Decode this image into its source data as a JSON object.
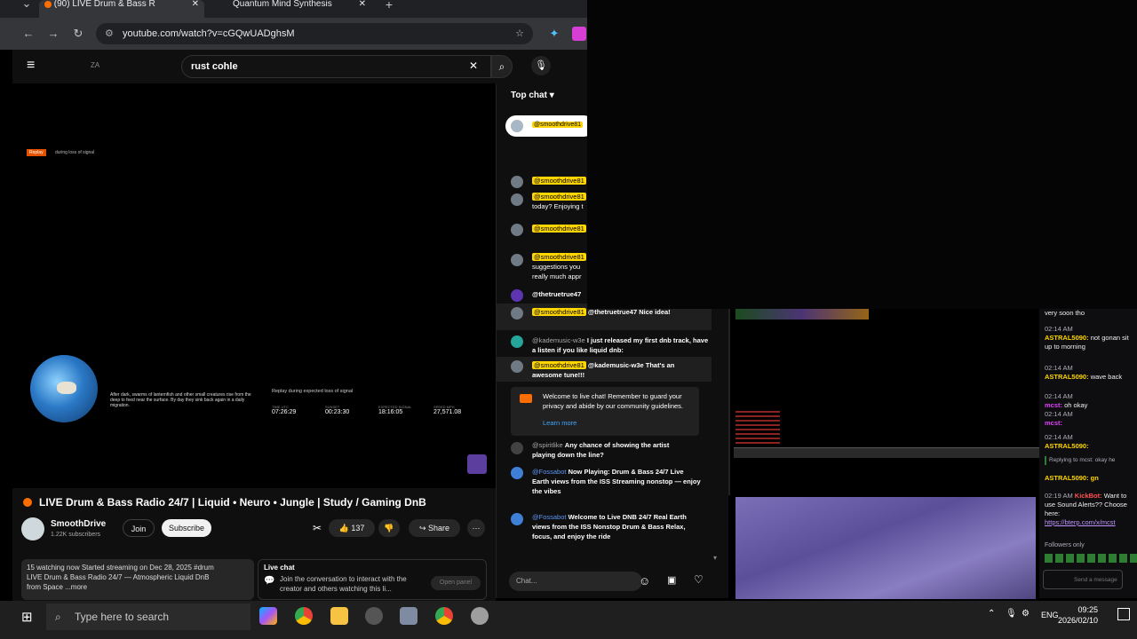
{
  "browser": {
    "tabs": [
      {
        "label": "(90)   LIVE Drum & Bass R"
      },
      {
        "label": "Quantum Mind Synthesis"
      }
    ],
    "url": "youtube.com/watch?v=cGQwUADghsM"
  },
  "youtube": {
    "logo_text": "ZA",
    "search_value": "rust cohle",
    "video_title": "LIVE Drum & Bass Radio 24/7 | Liquid • Neuro • Jungle | Study / Gaming DnB",
    "channel_name": "SmoothDrive",
    "subscribers": "1.22K subscribers",
    "join_label": "Join",
    "subscribe_label": "Subscribe",
    "likes": "137",
    "share_label": "Share",
    "description": "15 watching now  Started streaming on Dec 28, 2025  #drum",
    "description_line2": "LIVE Drum & Bass Radio 24/7 — Atmospheric Liquid DnB",
    "description_line3": "from Space ...more",
    "livechat_box_title": "Live chat",
    "livechat_box_text": "Join the conversation to interact with the creator and others watching this li...",
    "open_panel_label": "Open panel"
  },
  "player": {
    "replay_badge": "Replay",
    "replay_caption": "during loss of signal",
    "caption_text": "After dark, swarms of lanternfish and other small creatures rise from the deep to feed near the surface. By day they sink back again in a daily migration.",
    "panel_title": "Replay during expected loss of signal",
    "stats": [
      {
        "label": "TIME UTC",
        "value": "07:26:29"
      },
      {
        "label": "SUNSET",
        "value": "00:23:30"
      },
      {
        "label": "EXPECTED SIGNAL",
        "value": "18:16:05"
      },
      {
        "label": "SPEED MPH",
        "value": "27,571.08"
      }
    ]
  },
  "chat": {
    "header": "Top chat",
    "pinned": "@smoothdrive81",
    "messages": [
      {
        "user": "@smoothdrive81",
        "text": ""
      },
      {
        "user": "@smoothdrive81",
        "text": "today? Enjoying t"
      },
      {
        "user": "@smoothdrive81",
        "text": ""
      },
      {
        "user": "@smoothdrive81",
        "text": "suggestions you really much appr"
      },
      {
        "user": "@thetruetrue47",
        "text": ""
      },
      {
        "user": "@smoothdrive81",
        "text": "@thetruetrue47 Nice idea!"
      },
      {
        "user": "@kademusic-w3e",
        "text": "I just released my first dnb track, have a listen if you like liquid dnb:"
      },
      {
        "user": "@smoothdrive81",
        "text": "@kademusic-w3e That's an awesome tune!!!"
      }
    ],
    "welcome": "Welcome to live chat! Remember to guard your privacy and abide by our community guidelines.",
    "learn_more": "Learn more",
    "messages2": [
      {
        "user": "@spiritlike",
        "text": "Any chance of showing the artist playing down the line?"
      },
      {
        "user": "@Fossabot",
        "text": "Now Playing: Drum & Bass 24/7  Live Earth views from the ISS  Streaming nonstop — enjoy the vibes"
      },
      {
        "user": "@Fossabot",
        "text": "Welcome to Live DNB 24/7 Real Earth views from the ISS  Nonstop Drum & Bass  Relax, focus, and enjoy the ride"
      }
    ],
    "input_placeholder": "Chat..."
  },
  "twitch": {
    "top_text": "very soon tho",
    "lines": [
      {
        "time": "02:14 AM",
        "user": "ASTRAL5090:",
        "text": "not gonan sit up to morning"
      },
      {
        "time": "02:14 AM",
        "user": "ASTRAL5090:",
        "text": "wave back"
      },
      {
        "time": "02:14 AM",
        "user": "mcst:",
        "text": "oh okay"
      },
      {
        "time": "02:14 AM",
        "user": "mcst:",
        "text": ""
      },
      {
        "time": "02:14 AM",
        "user": "ASTRAL5090:",
        "text": ""
      }
    ],
    "reply_to": "Replying to mcst: okay he",
    "reply_line": "ASTRAL5090: gn",
    "bot_time": "02:19 AM",
    "bot_user": "KickBot:",
    "bot_text": "Want to use Sound Alerts?? Choose here:",
    "bot_link": "https://bterp.com/x/mcst",
    "followers_only": "Followers only",
    "send_label": "Send a message"
  },
  "taskbar": {
    "search_placeholder": "Type here to search",
    "language": "ENG",
    "time": "09:25",
    "date": "2026/02/10"
  }
}
